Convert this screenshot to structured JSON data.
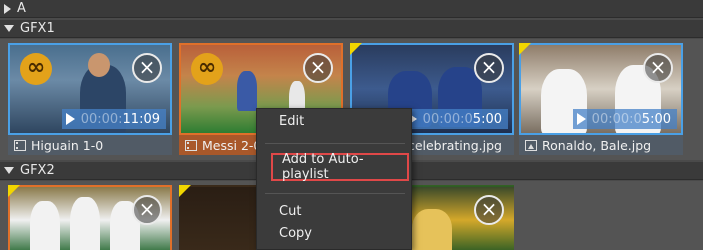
{
  "sections": {
    "a": {
      "label": "A"
    },
    "gfx1": {
      "label": "GFX1"
    },
    "gfx2": {
      "label": "GFX2"
    }
  },
  "gfx1_cards": [
    {
      "caption": "Higuain 1-0",
      "duration_prefix": "00:00:",
      "duration_value": "11:09",
      "type": "video",
      "looped": true,
      "selection": "blue",
      "flag": false
    },
    {
      "caption": "Messi 2-0",
      "duration_prefix": "",
      "duration_value": "",
      "type": "video",
      "looped": true,
      "selection": "orange",
      "flag": false
    },
    {
      "caption": "Ar...s celebrating.jpg",
      "duration_prefix": "00:00:0",
      "duration_value": "5:00",
      "type": "image",
      "looped": false,
      "selection": "blue",
      "flag": true
    },
    {
      "caption": "Ronaldo, Bale.jpg",
      "duration_prefix": "00:00:0",
      "duration_value": "5:00",
      "type": "image",
      "looped": false,
      "selection": "blue",
      "flag": true
    }
  ],
  "context_menu": {
    "items": [
      "Edit",
      "Add to Auto-playlist",
      "Cut",
      "Copy"
    ],
    "highlighted": "Add to Auto-playlist"
  },
  "icons": {
    "loop": "infinity-icon",
    "close": "close-icon",
    "play": "play-icon"
  },
  "colors": {
    "selection_blue": "#4aa0e6",
    "selection_orange": "#e0702a",
    "loop_badge": "#e3a21a",
    "flag": "#f2d600",
    "menu_highlight": "#e04848"
  }
}
